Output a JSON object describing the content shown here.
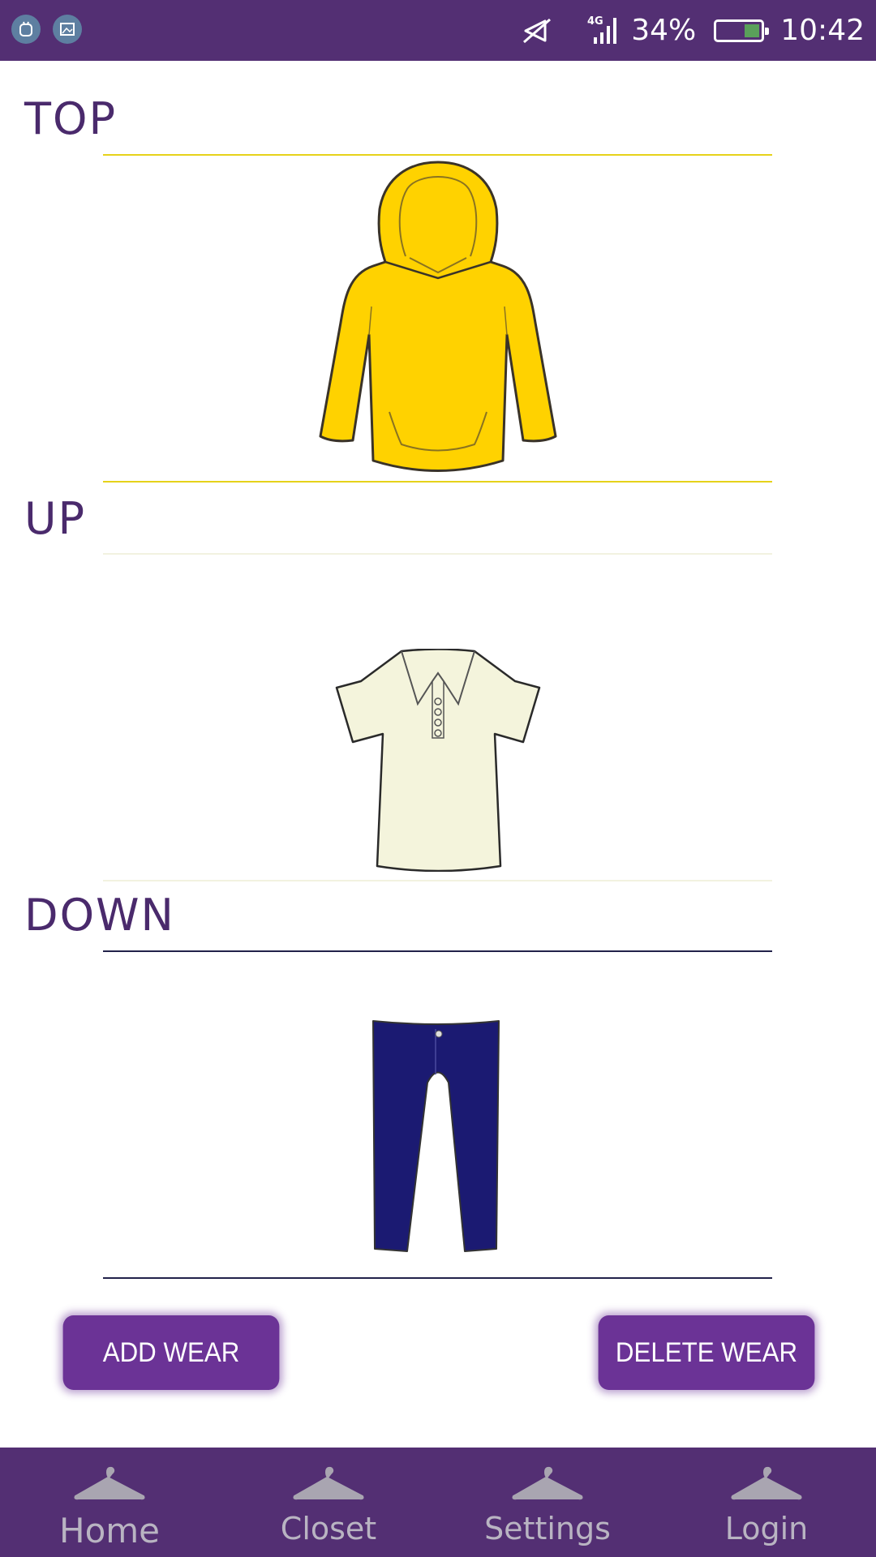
{
  "status_bar": {
    "network": "4G",
    "battery": "34%",
    "battery_level_percent": 34,
    "time": "10:42",
    "icons": [
      "android-debug-icon",
      "screenshot-icon",
      "mute-icon",
      "signal-icon",
      "battery-icon"
    ]
  },
  "sections": {
    "top": {
      "title": "TOP",
      "garment": "yellow-hoodie",
      "color": "#ffd200",
      "rule_color": "#e6d21a"
    },
    "up": {
      "title": "UP",
      "garment": "cream-polo-shirt",
      "color": "#f4f4dc",
      "rule_color": "#f2f2e0"
    },
    "down": {
      "title": "DOWN",
      "garment": "navy-jeans",
      "color": "#1b1a72",
      "rule_color": "#22224a"
    }
  },
  "buttons": {
    "add": "ADD WEAR",
    "delete": "DELETE WEAR"
  },
  "nav": {
    "items": [
      {
        "label": "Home",
        "icon": "hanger-icon",
        "active": true
      },
      {
        "label": "Closet",
        "icon": "hanger-icon",
        "active": false
      },
      {
        "label": "Settings",
        "icon": "hanger-icon",
        "active": false
      },
      {
        "label": "Login",
        "icon": "hanger-icon",
        "active": false
      }
    ]
  },
  "colors": {
    "brand": "#532f73",
    "title_text": "#4a2a6c",
    "button": "#6b3396",
    "nav_text": "#b9b4c2"
  }
}
